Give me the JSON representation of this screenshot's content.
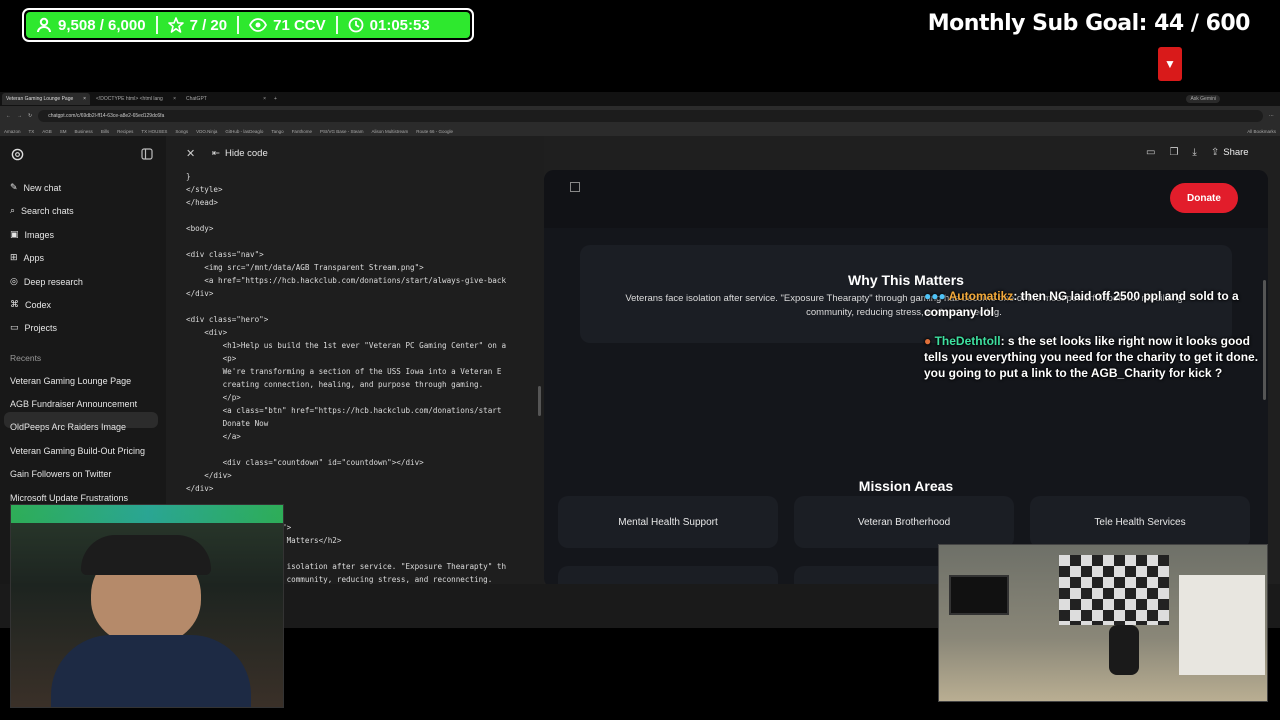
{
  "overlay": {
    "followers": "9,508 / 6,000",
    "stars": "7 / 20",
    "viewers": "71 CCV",
    "uptime": "01:05:53",
    "sub_goal": "Monthly Sub Goal:  44 / 600",
    "accent": "#2ee82e"
  },
  "browser": {
    "tabs": [
      "Veteran Gaming Lounge Page",
      "<!DOCTYPE html> <html lang",
      "ChatGPT"
    ],
    "url": "chatgpt.com/c/69db2l-ff14-63ce-a8e2-65ed129dc6fa",
    "ask_gemini": "Ask Gemini",
    "bookmarks": [
      "Amazon",
      "TX",
      "AGB",
      "SM",
      "Business",
      "Bills",
      "Recipes",
      "TX HOUSES",
      "Songs",
      "VDO.Ninja",
      "GitHub - lasDeaglo",
      "Tango",
      "Fanthome",
      "PSI/VG Base - Steam",
      "Alison Multistream",
      "Route 66 - Google",
      "All Bookmarks"
    ]
  },
  "sidebar": {
    "items": [
      "New chat",
      "Search chats",
      "Images",
      "Apps",
      "Deep research",
      "Codex",
      "Projects"
    ],
    "recents_label": "Recents",
    "recents": [
      "Veteran Gaming Lounge Page",
      "AGB Fundraiser Announcement",
      "OldPeeps Arc Raiders Image",
      "Veteran Gaming Build-Out Pricing",
      "Gain Followers on Twitter",
      "Microsoft Update Frustrations"
    ]
  },
  "codepane": {
    "hide_code": "Hide code",
    "lines": [
      "}",
      "</style>",
      "</head>",
      "",
      "<body>",
      "",
      "<div class=\"nav\">",
      "    <img src=\"/mnt/data/AGB Transparent Stream.png\">",
      "    <a href=\"https://hcb.hackclub.com/donations/start/always-give-back",
      "</div>",
      "",
      "<div class=\"hero\">",
      "    <div>",
      "        <h1>Help us build the 1st ever \"Veteran PC Gaming Center\" on a",
      "        <p>",
      "        We're transforming a section of the USS Iowa into a Veteran E",
      "        creating connection, healing, and purpose through gaming.",
      "        </p>",
      "        <a class=\"btn\" href=\"https://hcb.hackclub.com/donations/start",
      "        Donate Now",
      "        </a>",
      "",
      "        <div class=\"countdown\" id=\"countdown\"></div>",
      "    </div>",
      "</div>",
      "",
      "                    >",
      "                    s\">",
      "                    s Matters</h2>",
      "",
      "                    e isolation after service. \"Exposure Thearapty\" th",
      "                    g community, reducing stress, and reconnecting."
    ]
  },
  "toolbar": {
    "share": "Share"
  },
  "preview": {
    "donate": "Donate",
    "why_title": "Why This Matters",
    "why_text": "Veterans face isolation after service. \"Exposure Thearapty\" through gaming has become one of the most powerful tools for rebuilding community, reducing stress, and reconnecting.",
    "mission_title": "Mission Areas",
    "missions": [
      "Mental Health Support",
      "Veteran Brotherhood",
      "Tele Health Services"
    ]
  },
  "chat": [
    {
      "user": "Automatikz",
      "text": ": then NG laid off 2500 ppl and sold to a company lol"
    },
    {
      "user": "TheDethtoll",
      "text": ": s the set looks like right now it looks good tells you everything you need for the charity to get it done. you going to put a link to the AGB_Charity for kick ?"
    }
  ]
}
